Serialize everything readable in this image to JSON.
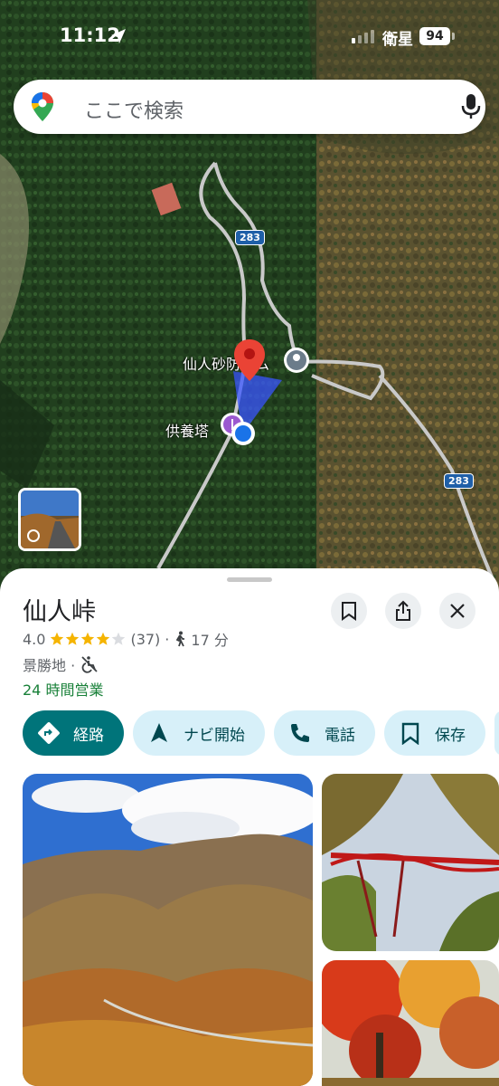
{
  "status_bar": {
    "time": "11:12",
    "carrier": "衛星",
    "battery": "94"
  },
  "search": {
    "placeholder": "ここで検索",
    "logo_icon": "google-maps-pin-icon",
    "mic_icon": "mic-icon"
  },
  "map": {
    "labels": {
      "dam": "仙人砂防ダム",
      "memorial": "供養塔"
    },
    "road_number": "283"
  },
  "place": {
    "name": "仙人峠",
    "rating": "4.0",
    "rating_value": 4.0,
    "review_count": "(37)",
    "walk_time": "17 分",
    "category": "景勝地 ·",
    "hours": "24 時間営業"
  },
  "actions": [
    {
      "label": "経路",
      "icon": "directions-icon"
    },
    {
      "label": "ナビ開始",
      "icon": "navigation-arrow-icon"
    },
    {
      "label": "電話",
      "icon": "phone-icon"
    },
    {
      "label": "保存",
      "icon": "bookmark-icon"
    }
  ],
  "colors": {
    "primary_action": "#00747a",
    "action_chip": "#d7f0f9",
    "open_hours": "#188038",
    "star": "#f5b400"
  }
}
